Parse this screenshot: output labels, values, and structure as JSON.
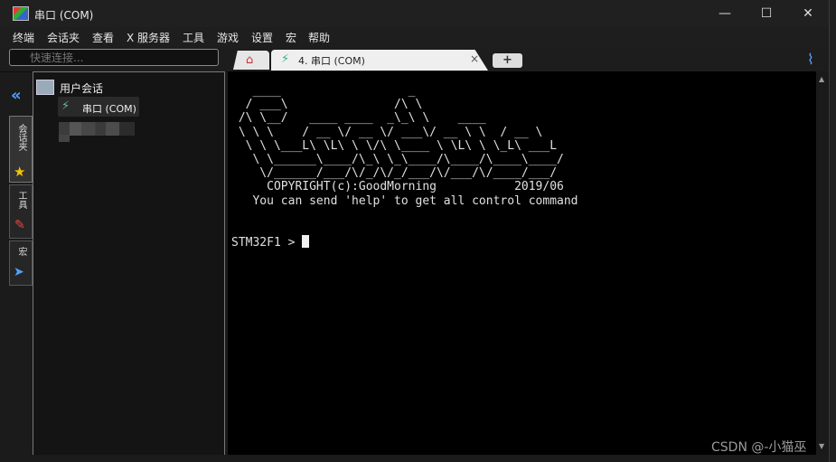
{
  "window": {
    "title": "串口 (COM)",
    "controls": {
      "minimize": "—",
      "maximize": "☐",
      "close": "✕"
    }
  },
  "menu": [
    "终端",
    "会话夹",
    "查看",
    "X 服务器",
    "工具",
    "游戏",
    "设置",
    "宏",
    "帮助"
  ],
  "toolbar": {
    "quick_connect_placeholder": "快速连接...",
    "home_tab_icon": "home-icon",
    "new_tab_label": "+"
  },
  "tabs": [
    {
      "icon": "serial-plug-icon",
      "label": "4. 串口 (COM)",
      "close": "×"
    }
  ],
  "sidebar": {
    "vertical_tabs": [
      "会话夹",
      "工具",
      "宏"
    ]
  },
  "session_tree": {
    "root_label": "用户会话",
    "children": [
      {
        "label": "串口 (COM)"
      }
    ]
  },
  "terminal": {
    "lines": [
      "   ____                  _  ",
      "  / ___\\               /\\ \\",
      " /\\ \\__/   ____ ____  _\\_\\ \\    ____",
      " \\ \\ \\    / __ \\/ __ \\/ ___\\/ __ \\ \\  / __ \\",
      "  \\ \\ \\___L\\ \\L\\ \\ \\/\\ \\____ \\ \\L\\ \\ \\_L\\ ___L",
      "   \\ \\______\\____/\\_\\ \\_\\____/\\____/\\____\\____/",
      "    \\/______/___/\\/_/\\/_/___/\\/___/\\/____/___/",
      "     COPYRIGHT(c):GoodMorning           2019/06",
      "   You can send 'help' to get all control command",
      "",
      "",
      "STM32F1 >"
    ]
  },
  "watermark": "CSDN @-小猫巫"
}
